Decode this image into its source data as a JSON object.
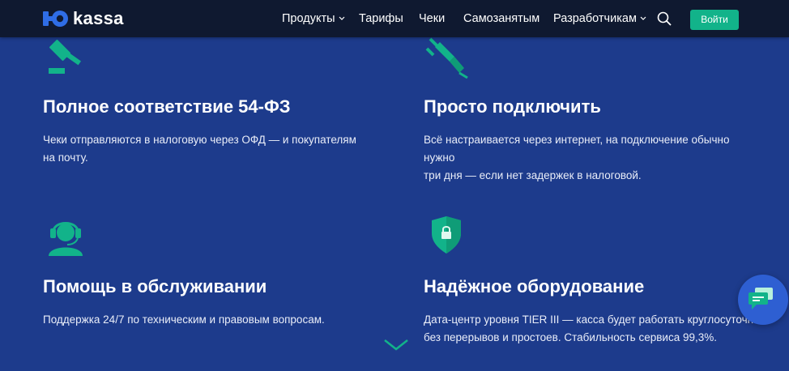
{
  "brand": {
    "logo_text": "kassa",
    "accent": "#12b38a",
    "header_bg": "#0f1930",
    "page_bg": "#1d3b8c"
  },
  "nav": {
    "items": [
      {
        "label": "Продукты",
        "dropdown": true
      },
      {
        "label": "Тарифы",
        "dropdown": false
      },
      {
        "label": "Чеки",
        "dropdown": false
      },
      {
        "label": "Самозанятым",
        "dropdown": false
      },
      {
        "label": "Разработчикам",
        "dropdown": true
      }
    ],
    "search_icon": "search-icon",
    "login_label": "Войти"
  },
  "features": [
    {
      "icon": "gavel-icon",
      "title": "Полное соответствие 54-ФЗ",
      "desc": [
        "Чеки отправляются в налоговую через ОФД — и покупателям",
        "на почту."
      ]
    },
    {
      "icon": "plug-icon",
      "title": "Просто подключить",
      "desc": [
        "Всё настраивается через интернет, на подключение обычно нужно",
        "три дня — если нет задержек в налоговой."
      ]
    },
    {
      "icon": "support-agent-icon",
      "title": "Помощь в обслуживании",
      "desc": [
        "Поддержка 24/7 по техническим и правовым вопросам.",
        ""
      ]
    },
    {
      "icon": "shield-lock-icon",
      "title": "Надёжное оборудование",
      "desc": [
        "Дата-центр уровня TIER III — касса будет работать круглосуточно",
        "без перерывов и простоев. Стабильность сервиса 99,3%."
      ]
    }
  ],
  "widgets": {
    "chat_icon": "chat-icon",
    "scroll_icon": "chevron-down-icon"
  }
}
